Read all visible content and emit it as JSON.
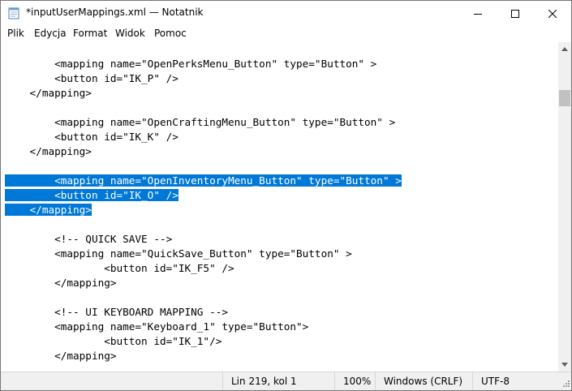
{
  "window": {
    "title": "*inputUserMappings.xml — Notatnik"
  },
  "menu": [
    "Plik",
    "Edycja",
    "Format",
    "Widok",
    "Pomoc"
  ],
  "editor": {
    "lines": [
      {
        "text": "        <mapping name=\"OpenPerksMenu_Button\" type=\"Button\" >",
        "selected": false
      },
      {
        "text": "        <button id=\"IK_P\" />",
        "selected": false
      },
      {
        "text": "    </mapping>",
        "selected": false
      },
      {
        "text": "",
        "selected": false
      },
      {
        "text": "        <mapping name=\"OpenCraftingMenu_Button\" type=\"Button\" >",
        "selected": false
      },
      {
        "text": "        <button id=\"IK_K\" />",
        "selected": false
      },
      {
        "text": "    </mapping>",
        "selected": false
      },
      {
        "text": "",
        "selected": false
      },
      {
        "text": "        <mapping name=\"OpenInventoryMenu_Button\" type=\"Button\" >",
        "selected": true
      },
      {
        "text": "        <button id=\"IK_O\" />",
        "selected": true
      },
      {
        "text": "    </mapping>",
        "selected": true
      },
      {
        "text": "",
        "selected": false
      },
      {
        "text": "        <!-- QUICK SAVE -->",
        "selected": false
      },
      {
        "text": "        <mapping name=\"QuickSave_Button\" type=\"Button\" >",
        "selected": false
      },
      {
        "text": "                <button id=\"IK_F5\" />",
        "selected": false
      },
      {
        "text": "        </mapping>",
        "selected": false
      },
      {
        "text": "",
        "selected": false
      },
      {
        "text": "        <!-- UI KEYBOARD MAPPING -->",
        "selected": false
      },
      {
        "text": "        <mapping name=\"Keyboard_1\" type=\"Button\">",
        "selected": false
      },
      {
        "text": "                <button id=\"IK_1\"/>",
        "selected": false
      },
      {
        "text": "        </mapping>",
        "selected": false
      }
    ],
    "scroll_position": 0.12
  },
  "status": {
    "position": "Lin 219, kol 1",
    "zoom": "100%",
    "line_ending": "Windows (CRLF)",
    "encoding": "UTF-8"
  },
  "colors": {
    "selection": "#0078d7",
    "statusbar": "#f0f0f0"
  }
}
